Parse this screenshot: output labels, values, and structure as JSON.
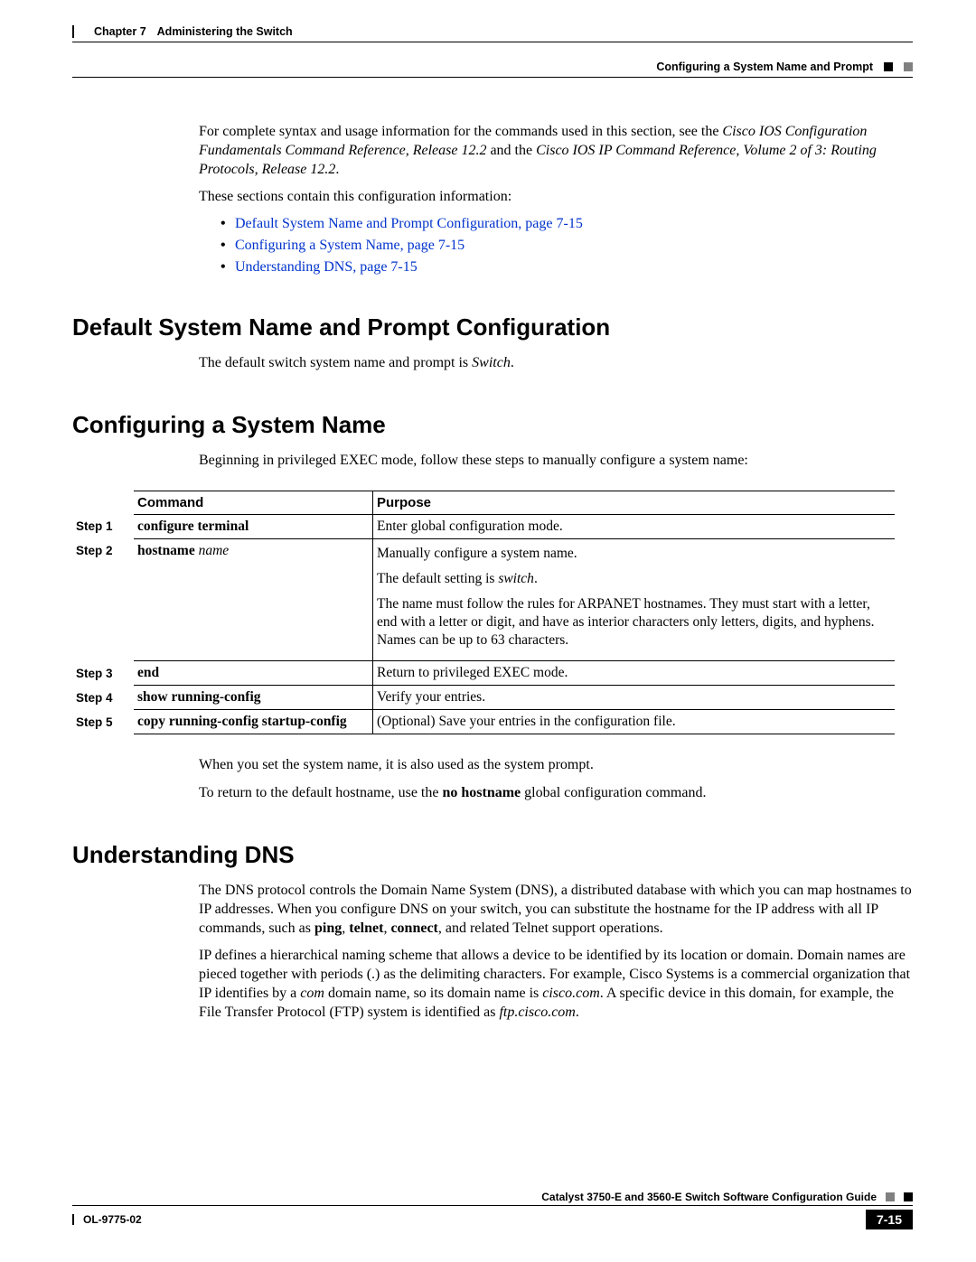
{
  "header": {
    "chapter_label": "Chapter 7",
    "chapter_title": "Administering the Switch",
    "section_title": "Configuring a System Name and Prompt"
  },
  "intro": {
    "p1_a": "For complete syntax and usage information for the commands used in this section, see the ",
    "p1_b": "Cisco IOS Configuration Fundamentals Command Reference, Release 12.2",
    "p1_c": " and the ",
    "p1_d": "Cisco IOS IP Command Reference, Volume 2 of 3: Routing Protocols, Release 12.2",
    "p1_e": ".",
    "p2": "These sections contain this configuration information:",
    "links": {
      "l1": "Default System Name and Prompt Configuration, page 7-15",
      "l2": "Configuring a System Name, page 7-15",
      "l3": "Understanding DNS, page 7-15"
    }
  },
  "sec1": {
    "heading": "Default System Name and Prompt Configuration",
    "p_a": "The default switch system name and prompt is ",
    "p_b": "Switch",
    "p_c": "."
  },
  "sec2": {
    "heading": "Configuring a System Name",
    "intro": "Beginning in privileged EXEC mode, follow these steps to manually configure a system name:",
    "th": {
      "cmd": "Command",
      "purpose": "Purpose"
    },
    "rows": {
      "r1": {
        "step": "Step 1",
        "cmd": "configure terminal",
        "purpose": "Enter global configuration mode."
      },
      "r2": {
        "step": "Step 2",
        "cmd": "hostname ",
        "arg": "name",
        "p1": "Manually configure a system name.",
        "p2a": "The default setting is ",
        "p2b": "switch",
        "p2c": ".",
        "p3": "The name must follow the rules for ARPANET hostnames. They must start with a letter, end with a letter or digit, and have as interior characters only letters, digits, and hyphens. Names can be up to 63 characters."
      },
      "r3": {
        "step": "Step 3",
        "cmd": "end",
        "purpose": "Return to privileged EXEC mode."
      },
      "r4": {
        "step": "Step 4",
        "cmd": "show running-config",
        "purpose": "Verify your entries."
      },
      "r5": {
        "step": "Step 5",
        "cmd": "copy running-config startup-config",
        "purpose": "(Optional) Save your entries in the configuration file."
      }
    },
    "after1": "When you set the system name, it is also used as the system prompt.",
    "after2a": "To return to the default hostname, use the ",
    "after2b": "no hostname",
    "after2c": " global configuration command."
  },
  "sec3": {
    "heading": "Understanding DNS",
    "p1a": "The DNS protocol controls the Domain Name System (DNS), a distributed database with which you can map hostnames to IP addresses. When you configure DNS on your switch, you can substitute the hostname for the IP address with all IP commands, such as ",
    "p1b": "ping",
    "p1c": ", ",
    "p1d": "telnet",
    "p1e": ", ",
    "p1f": "connect",
    "p1g": ", and related Telnet support operations.",
    "p2a": "IP defines a hierarchical naming scheme that allows a device to be identified by its location or domain. Domain names are pieced together with periods (.) as the delimiting characters. For example, Cisco Systems is a commercial organization that IP identifies by a ",
    "p2b": "com",
    "p2c": " domain name, so its domain name is ",
    "p2d": "cisco.com",
    "p2e": ". A specific device in this domain, for example, the File Transfer Protocol (FTP) system is identified as ",
    "p2f": "ftp.cisco.com",
    "p2g": "."
  },
  "footer": {
    "guide": "Catalyst 3750-E and 3560-E Switch Software Configuration Guide",
    "doc": "OL-9775-02",
    "page": "7-15"
  }
}
